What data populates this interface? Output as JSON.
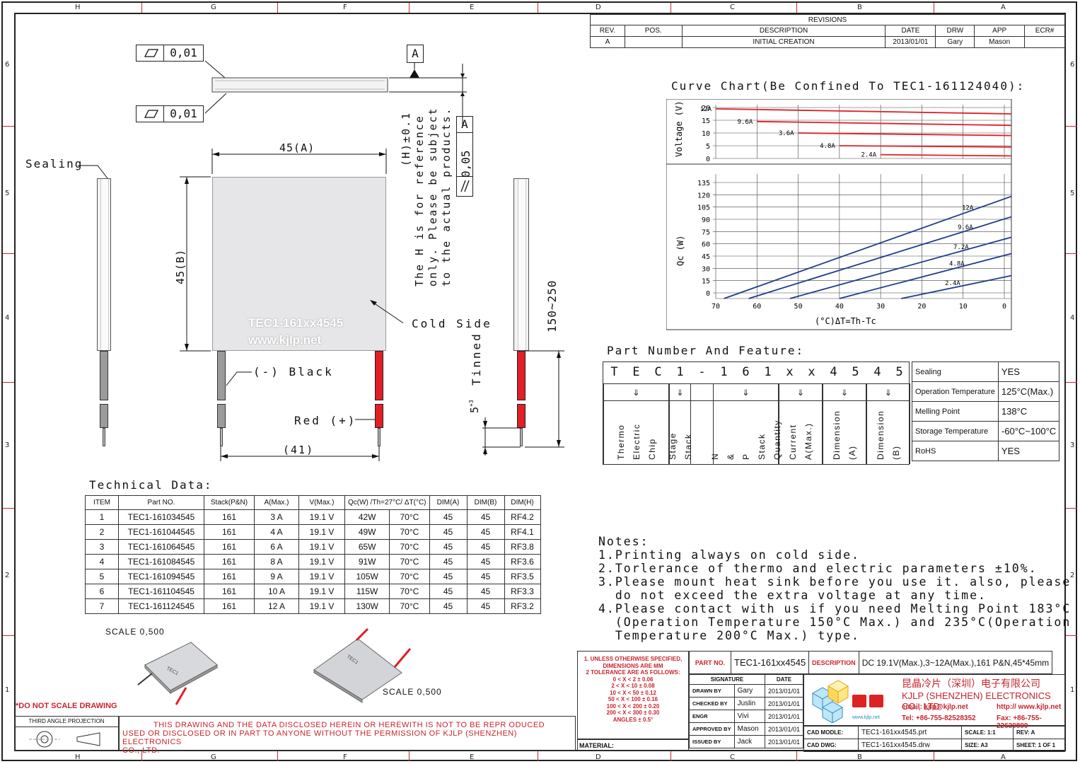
{
  "frame": {
    "col_labels": [
      "H",
      "G",
      "F",
      "E",
      "D",
      "C",
      "B",
      "A"
    ],
    "row_labels": [
      "6",
      "5",
      "4",
      "3",
      "2",
      "1"
    ]
  },
  "revisions": {
    "title": "REVISIONS",
    "headers": [
      "REV.",
      "POS.",
      "DESCRIPTION",
      "DATE",
      "DRW",
      "APP",
      "ECR#"
    ],
    "row": [
      "A",
      "",
      "INITIAL CREATION",
      "2013/01/01",
      "Gary",
      "Mason",
      ""
    ]
  },
  "datum": {
    "flatness_value": "0,01",
    "flatness_value_2": "0,01",
    "datum_letter": "A",
    "parallel_value": "0,05",
    "parallel_ref": "A"
  },
  "h_note": [
    "(H)±0.1",
    "The H is for reference",
    "only. Please be subject",
    "to the actual products."
  ],
  "dims": {
    "width": "45(A)",
    "height": "45(B)",
    "lead_spacing": "(41)",
    "lead_length": "150~250",
    "tinned": "Tinned",
    "tinned_len": "5",
    "tinned_tol_plus": "+3",
    "tinned_tol_zero": "0"
  },
  "labels": {
    "sealing": "Sealing",
    "cold_side": "Cold Side",
    "black": "(-) Black",
    "red": "Red (+)",
    "print_line1": "TEC1-161xx4545",
    "print_line2": "www.kjlp.net"
  },
  "curve_title": "Curve Chart(Be Confined To TEC1-161124040):",
  "chart_data": [
    {
      "type": "line",
      "ylabel": "Voltage (V)",
      "y_ticks": [
        "20",
        "15",
        "10",
        "5",
        "0"
      ],
      "series": [
        {
          "name": "12A",
          "x": [
            70,
            0
          ],
          "values": [
            19.5,
            17.5
          ]
        },
        {
          "name": "9.6A",
          "x": [
            60,
            0
          ],
          "values": [
            14.5,
            13.0
          ]
        },
        {
          "name": "3.6A",
          "x": [
            50,
            0
          ],
          "values": [
            10.0,
            9.0
          ]
        },
        {
          "name": "4.8A",
          "x": [
            40,
            0
          ],
          "values": [
            5.0,
            4.5
          ]
        },
        {
          "name": "2.4A",
          "x": [
            30,
            0
          ],
          "values": [
            1.5,
            1.0
          ]
        }
      ],
      "color": "#e21e26"
    },
    {
      "type": "line",
      "ylabel": "Qc (W)",
      "xlabel": "(°C)ΔT=Th-Tc",
      "x_ticks": [
        "70",
        "60",
        "50",
        "40",
        "30",
        "20",
        "10",
        "0"
      ],
      "y_ticks": [
        "135",
        "120",
        "105",
        "90",
        "75",
        "60",
        "45",
        "30",
        "15",
        "0"
      ],
      "series": [
        {
          "name": "12A",
          "x": [
            68,
            0
          ],
          "values": [
            0,
            125
          ]
        },
        {
          "name": "9.6A",
          "x": [
            62,
            0
          ],
          "values": [
            0,
            100
          ]
        },
        {
          "name": "7.2A",
          "x": [
            52,
            0
          ],
          "values": [
            0,
            75
          ]
        },
        {
          "name": "4.8A",
          "x": [
            40,
            0
          ],
          "values": [
            0,
            55
          ]
        },
        {
          "name": "2.4A",
          "x": [
            25,
            0
          ],
          "values": [
            0,
            28
          ]
        }
      ],
      "color": "#1f3b8c"
    }
  ],
  "part_number": {
    "title": "Part Number And Feature:",
    "chars": [
      "T",
      "E",
      "C",
      "1",
      "-",
      "1",
      "6",
      "1",
      "x",
      "x",
      "4",
      "5",
      "4",
      "5"
    ],
    "groups": [
      "Thermo Electric Chip",
      "Stage Stack",
      "N & P Stack Quantity",
      "Current A(Max.)",
      "Dimension (A)",
      "Dimension (B)"
    ],
    "features": [
      {
        "k": "Sealing",
        "v": "YES"
      },
      {
        "k": "Operation Temperature",
        "v": "125°C(Max.)"
      },
      {
        "k": "Melling Point",
        "v": "138°C"
      },
      {
        "k": "Storage Temperature",
        "v": "-60°C~100°C"
      },
      {
        "k": "RoHS",
        "v": "YES"
      }
    ]
  },
  "technical": {
    "title": "Technical Data:",
    "headers": [
      "ITEM",
      "Part NO.",
      "Stack(P&N)",
      "A(Max.)",
      "V(Max.)",
      "Qc(W) /Th=27°C/ ΔT(°C)",
      "",
      "DIM(A)",
      "DIM(B)",
      "DIM(H)"
    ],
    "rows": [
      [
        "1",
        "TEC1-161034545",
        "161",
        "3 A",
        "19.1 V",
        "42W",
        "70°C",
        "45",
        "45",
        "RF4.2"
      ],
      [
        "2",
        "TEC1-161044545",
        "161",
        "4 A",
        "19.1 V",
        "49W",
        "70°C",
        "45",
        "45",
        "RF4.1"
      ],
      [
        "3",
        "TEC1-161064545",
        "161",
        "6 A",
        "19.1 V",
        "65W",
        "70°C",
        "45",
        "45",
        "RF3.8"
      ],
      [
        "4",
        "TEC1-161084545",
        "161",
        "8 A",
        "19.1 V",
        "91W",
        "70°C",
        "45",
        "45",
        "RF3.6"
      ],
      [
        "5",
        "TEC1-161094545",
        "161",
        "9 A",
        "19.1 V",
        "105W",
        "70°C",
        "45",
        "45",
        "RF3.5"
      ],
      [
        "6",
        "TEC1-161104545",
        "161",
        "10 A",
        "19.1 V",
        "115W",
        "70°C",
        "45",
        "45",
        "RF3.3"
      ],
      [
        "7",
        "TEC1-161124545",
        "161",
        "12 A",
        "19.1 V",
        "130W",
        "70°C",
        "45",
        "45",
        "RF3.2"
      ]
    ]
  },
  "scale_label_1": "SCALE 0,500",
  "scale_label_2": "SCALE 0,500",
  "notes": {
    "title": "Notes:",
    "lines": [
      "1.Printing always on cold side.",
      "2.Torlerance of thermo and electric parameters ±10%.",
      "3.Please mount heat sink before you use it. also, please",
      "  do not exceed the extra voltage at any time.",
      "4.Please contact with us if you need Melting Point 183°C",
      "  (Operation Temperature 150°C Max.) and 235°C(Operation",
      "  Temperature 200°C Max.) type."
    ]
  },
  "footer": {
    "do_not_scale": "*DO NOT SCALE DRAWING",
    "projection": "THIRD ANGLE PROJECTION",
    "disclaimer_1": "THIS DRAWING AND THE DATA DISCLOSED HEREIN OR HEREWITH IS NOT TO BE REPR ODUCED",
    "disclaimer_2": "USED OR DISCLOSED OR IN PART TO ANYONE WITHOUT THE PERMISSION OF KJLP (SHENZHEN) ELECTRONICS",
    "disclaimer_3": "CO., LTD.",
    "material": "MATERIAL:"
  },
  "tolerances": {
    "lines": [
      "1. UNLESS OTHERWISE SPECIFIED,",
      "DIMENSIONS ARE MM",
      "2 TOLERANCE ARE AS FOLLOWS:",
      "0 < X <   2  ± 0.06",
      "2 < X <  10  ± 0.08",
      "10 < X <  50  ± 0.12",
      "50 < X < 100  ± 0.16",
      "100 < X < 200  ± 0.20",
      "200 < X < 300  ± 0.30",
      "ANGLES ± 0.5°"
    ]
  },
  "title_block": {
    "part_no_label": "PART NO.",
    "part_no": "TEC1-161xx4545",
    "desc_label": "DESCRIPTION",
    "desc": "DC 19.1V(Max.),3~12A(Max.),161 P&N,45*45mm",
    "sig_head": "SIGNATURE",
    "date_head": "DATE",
    "rows": [
      {
        "role": "DRAWN BY",
        "name": "Gary",
        "date": "2013/01/01"
      },
      {
        "role": "CHECKED BY",
        "name": "Juslin",
        "date": "2013/01/01"
      },
      {
        "role": "ENGR",
        "name": "Vivi",
        "date": "2013/01/01"
      },
      {
        "role": "APPROVED BY",
        "name": "Mason",
        "date": "2013/01/01"
      },
      {
        "role": "ISSUED BY",
        "name": "Jack",
        "date": "2013/01/01"
      }
    ],
    "company_cn": "昆晶冷片（深圳）电子有限公司",
    "company_en": "KJLP (SHENZHEN) ELECTRONICS CO., LTD",
    "email": "email: kjlp@kjlp.net",
    "http": "http:// www.kjlp.net",
    "tel": "Tel: +86-755-82528352",
    "fax": "Fax: +86-755-22639899",
    "logo_url": "www.kjlp.net",
    "cad_model_label": "CAD MODLE:",
    "cad_model": "TEC1-161xx4545.prt",
    "cad_dwg_label": "CAD DWG:",
    "cad_dwg": "TEC1-161xx4545.drw",
    "scale_label": "SCALE: 1:1",
    "size_label": "SIZE: A3",
    "rev_label": "REV: A",
    "sheet_label": "SHEET: 1 OF 1"
  }
}
